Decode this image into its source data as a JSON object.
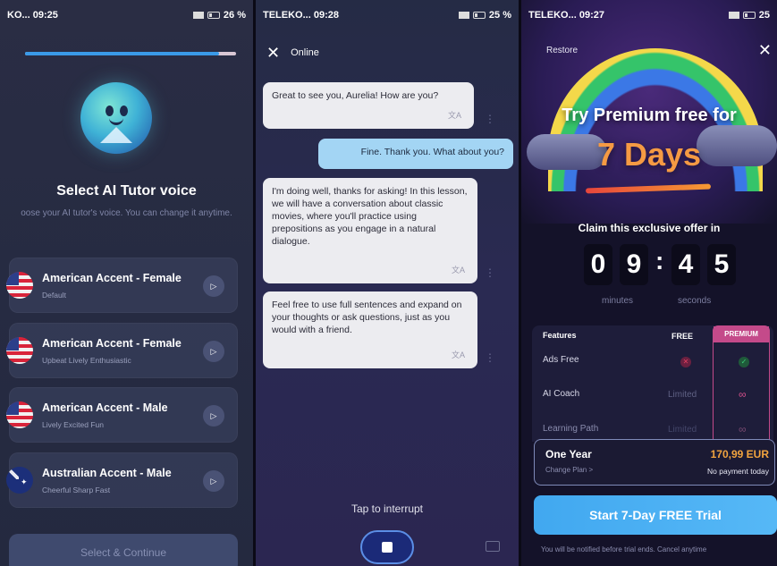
{
  "colors": {
    "accent_blue": "#41a8f0",
    "premium_pink": "#c44a8a",
    "price_orange": "#f2a43f",
    "panel_dark": "#141229"
  },
  "panel1": {
    "status": {
      "carrier": "KO... 09:25",
      "battery": "26 %"
    },
    "progress": 0.92,
    "title": "Select AI Tutor voice",
    "subtitle": "oose your AI tutor's voice. You can change it anytime.",
    "voices": [
      {
        "name": "American Accent - Female",
        "tags": "Default",
        "flag": "us-flag-icon"
      },
      {
        "name": "American Accent - Female",
        "tags": "Upbeat  Lively  Enthusiastic",
        "flag": "us-flag-icon"
      },
      {
        "name": "American Accent - Male",
        "tags": "Lively  Excited  Fun",
        "flag": "us-flag-icon"
      },
      {
        "name": "Australian Accent - Male",
        "tags": "Cheerful  Sharp  Fast",
        "flag": "au-flag-icon"
      }
    ],
    "continue_label": "Select & Continue"
  },
  "panel2": {
    "status": {
      "carrier": "TELEKO... 09:28",
      "battery": "25 %"
    },
    "header_status": "Online",
    "messages": [
      {
        "role": "tutor",
        "text": "Great to see you, Aurelia! How are you?"
      },
      {
        "role": "user",
        "text": "Fine. Thank you. What about you?"
      },
      {
        "role": "tutor",
        "text": "I'm doing well, thanks for asking! In this lesson, we will have a conversation about classic movies, where you'll practice using prepositions as you engage in a natural dialogue."
      },
      {
        "role": "tutor",
        "text": "Feel free to use full sentences and expand on your thoughts or ask questions, just as you would with a friend."
      }
    ],
    "interrupt_label": "Tap to interrupt"
  },
  "panel3": {
    "status": {
      "carrier": "TELEKO... 09:27",
      "battery": "25"
    },
    "restore_label": "Restore",
    "headline_1": "Try Premium free for",
    "headline_2": "7 Days",
    "claim_label": "Claim this exclusive offer in",
    "timer": {
      "m1": "0",
      "m2": "9",
      "s1": "4",
      "s2": "5",
      "minutes_label": "minutes",
      "seconds_label": "seconds"
    },
    "features": {
      "col_features": "Features",
      "col_free": "FREE",
      "col_premium": "PREMIUM",
      "rows": [
        {
          "name": "Ads Free",
          "free": "✕",
          "premium": "✓"
        },
        {
          "name": "AI Coach",
          "free": "Limited",
          "premium": "∞"
        },
        {
          "name": "Learning Path",
          "free": "Limited",
          "premium": "∞"
        }
      ]
    },
    "plan": {
      "name": "One Year",
      "change": "Change Plan >",
      "price": "170,99 EUR",
      "no_payment": "No payment today"
    },
    "cta_label": "Start 7-Day FREE Trial",
    "notice": "You will be notified before trial ends. Cancel anytime"
  }
}
